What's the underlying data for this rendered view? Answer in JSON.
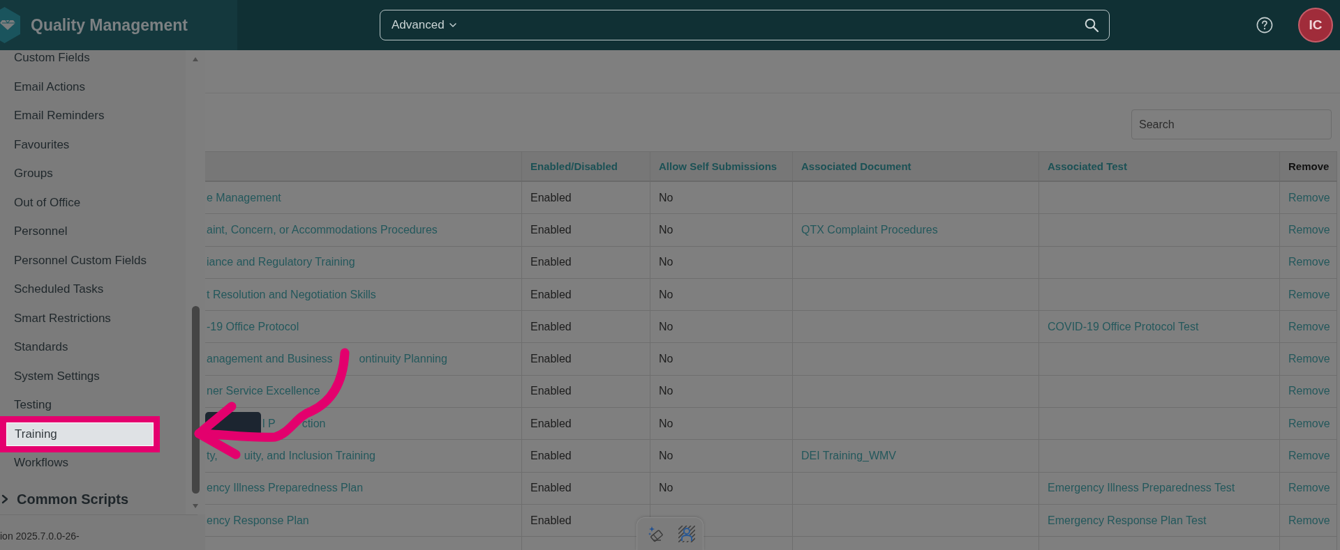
{
  "top_bar": {
    "title": "Quality Management",
    "search": {
      "mode": "Advanced"
    },
    "avatar": {
      "initials": "IC"
    }
  },
  "sidebar": {
    "items": [
      {
        "label": "Custom Fields",
        "highlighted": false
      },
      {
        "label": "Email Actions",
        "highlighted": false
      },
      {
        "label": "Email Reminders",
        "highlighted": false
      },
      {
        "label": "Favourites",
        "highlighted": false
      },
      {
        "label": "Groups",
        "highlighted": false
      },
      {
        "label": "Out of Office",
        "highlighted": false
      },
      {
        "label": "Personnel",
        "highlighted": false
      },
      {
        "label": "Personnel Custom Fields",
        "highlighted": false
      },
      {
        "label": "Scheduled Tasks",
        "highlighted": false
      },
      {
        "label": "Smart Restrictions",
        "highlighted": false
      },
      {
        "label": "Standards",
        "highlighted": false
      },
      {
        "label": "System Settings",
        "highlighted": false
      },
      {
        "label": "Testing",
        "highlighted": false
      },
      {
        "label": "Training",
        "highlighted": true
      },
      {
        "label": "Workflows",
        "highlighted": false
      }
    ],
    "section": {
      "label": "Common Scripts",
      "expanded": false
    },
    "version": "ion 2025.7.0.0-26-"
  },
  "search": {
    "placeholder": "Search"
  },
  "table": {
    "columns": [
      {
        "label": "Enabled/Disabled",
        "sortable": true
      },
      {
        "label": "Allow Self Submissions",
        "sortable": true
      },
      {
        "label": "Associated Document",
        "sortable": true
      },
      {
        "label": "Associated Test",
        "sortable": true
      },
      {
        "label": "Remove",
        "sortable": false
      }
    ],
    "rows": [
      {
        "column_1": [
          "e Management"
        ],
        "enabled_disabled": "Enabled",
        "allow_self_submissions": "No",
        "remove": "Remove",
        "tooltip": false
      },
      {
        "column_1": [
          "aint, Concern, or Accommodations Procedures"
        ],
        "enabled_disabled": "Enabled",
        "allow_self_submissions": "No",
        "associated_document": "QTX Complaint Procedures",
        "remove": "Remove",
        "tooltip": false
      },
      {
        "column_1": [
          "iance and Regulatory Training"
        ],
        "enabled_disabled": "Enabled",
        "allow_self_submissions": "No",
        "remove": "Remove",
        "tooltip": false
      },
      {
        "column_1": [
          "t Resolution and Negotiation Skills"
        ],
        "enabled_disabled": "Enabled",
        "allow_self_submissions": "No",
        "remove": "Remove",
        "tooltip": false
      },
      {
        "column_1": [
          "-19 Office Protocol"
        ],
        "enabled_disabled": "Enabled",
        "allow_self_submissions": "No",
        "associated_test": "COVID-19 Office Protocol Test",
        "remove": "Remove",
        "tooltip": false
      },
      {
        "column_1": [
          "anagement and Business",
          "ontinuity Planning"
        ],
        "enabled_disabled": "Enabled",
        "allow_self_submissions": "No",
        "remove": "Remove",
        "tooltip": false
      },
      {
        "column_1": [
          "ner Service Excellence"
        ],
        "enabled_disabled": "Enabled",
        "allow_self_submissions": "No",
        "remove": "Remove",
        "tooltip": false
      },
      {
        "column_1": [
          "l P",
          "ction"
        ],
        "enabled_disabled": "Enabled",
        "allow_self_submissions": "No",
        "remove": "Remove",
        "tooltip": true
      },
      {
        "column_1": [
          "ty,",
          "uity, and Inclusion Training"
        ],
        "enabled_disabled": "Enabled",
        "allow_self_submissions": "No",
        "associated_document": "DEI Training_WMV",
        "remove": "Remove",
        "tooltip": false
      },
      {
        "column_1": [
          "ency Illness Preparedness Plan"
        ],
        "enabled_disabled": "Enabled",
        "allow_self_submissions": "No",
        "associated_test": "Emergency Illness Preparedness Test",
        "remove": "Remove",
        "tooltip": false
      },
      {
        "column_1": [
          "ency Response Plan"
        ],
        "enabled_disabled": "Enabled",
        "associated_test": "Emergency Response Plan Test",
        "remove": "Remove",
        "tooltip": false
      }
    ]
  }
}
